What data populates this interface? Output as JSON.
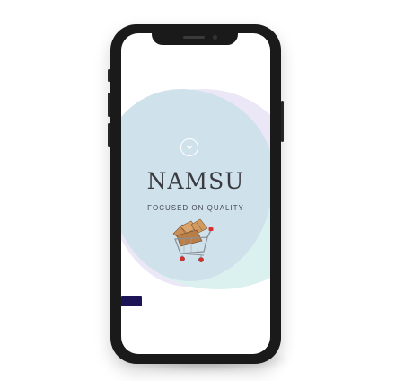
{
  "hero": {
    "brand_name": "NAMSU",
    "tagline": "FOCUSED ON QUALITY"
  },
  "icons": {
    "scroll_indicator": "chevron-down-icon",
    "hero_image": "shopping-cart-with-boxes-icon"
  },
  "colors": {
    "phone_frame": "#1a1a1a",
    "blob_blue": "#cfe2ec",
    "blob_lavender": "#ebe7f6",
    "blob_mint": "#dbf1ef",
    "brand_text": "#3a3a40",
    "tab_accent": "#1c1457",
    "cart_red": "#d9302c"
  }
}
